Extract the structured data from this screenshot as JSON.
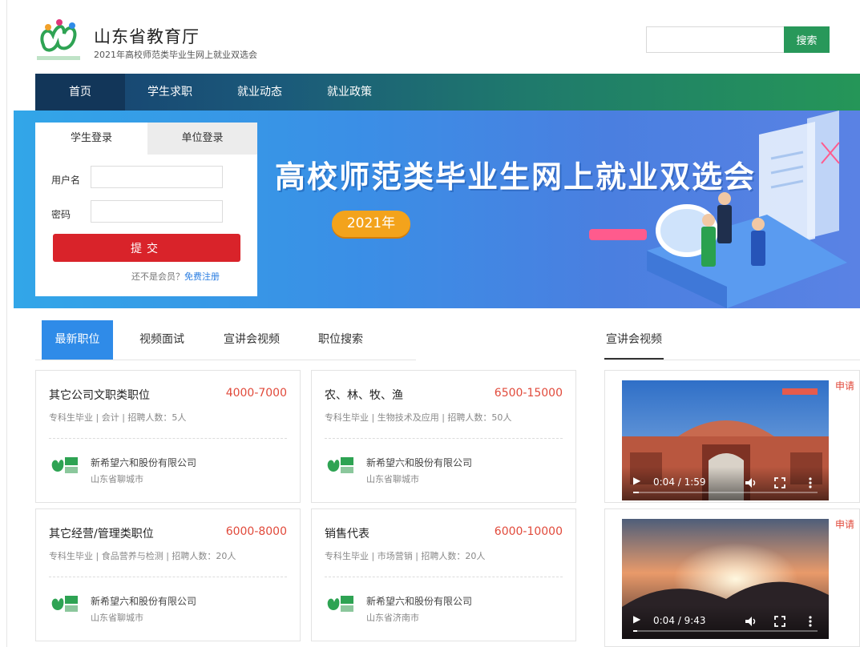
{
  "header": {
    "title": "山东省教育厅",
    "subtitle": "2021年高校师范类毕业生网上就业双选会",
    "search_placeholder": "",
    "search_button": "搜索"
  },
  "nav": {
    "items": [
      {
        "label": "首页",
        "active": true
      },
      {
        "label": "学生求职",
        "active": false
      },
      {
        "label": "就业动态",
        "active": false
      },
      {
        "label": "就业政策",
        "active": false
      }
    ]
  },
  "banner": {
    "title": "高校师范类毕业生网上就业双选会",
    "year": "2021年"
  },
  "login": {
    "tabs": [
      "学生登录",
      "单位登录"
    ],
    "username_label": "用户名",
    "password_label": "密码",
    "submit_label": "提交",
    "register_prefix": "还不是会员？",
    "register_link": "免费注册"
  },
  "job_tabs": [
    "最新职位",
    "视频面试",
    "宣讲会视频",
    "职位搜索"
  ],
  "side_heading": "宣讲会视频",
  "jobs": [
    {
      "title": "其它公司文职类职位",
      "salary": "4000-7000",
      "meta": "专科生毕业 | 会计 | 招聘人数：5人",
      "company": "新希望六和股份有限公司",
      "location": "山东省聊城市"
    },
    {
      "title": "农、林、牧、渔",
      "salary": "6500-15000",
      "meta": "专科生毕业 | 生物技术及应用 | 招聘人数：50人",
      "company": "新希望六和股份有限公司",
      "location": "山东省聊城市"
    },
    {
      "title": "其它经营/管理类职位",
      "salary": "6000-8000",
      "meta": "专科生毕业 | 食品营养与检测 | 招聘人数：20人",
      "company": "新希望六和股份有限公司",
      "location": "山东省聊城市"
    },
    {
      "title": "销售代表",
      "salary": "6000-10000",
      "meta": "专科生毕业 | 市场营销 | 招聘人数：20人",
      "company": "新希望六和股份有限公司",
      "location": "山东省济南市"
    }
  ],
  "videos": [
    {
      "apply": "申请",
      "time": "0:04 / 1:59",
      "progress": 0.03
    },
    {
      "apply": "申请",
      "time": "0:04 / 9:43",
      "progress": 0.01
    }
  ],
  "colors": {
    "accent_green": "#28985a",
    "nav_active": "#123659",
    "submit_red": "#d9232a",
    "tab_blue": "#2f8be8",
    "salary_red": "#e14a3b"
  }
}
